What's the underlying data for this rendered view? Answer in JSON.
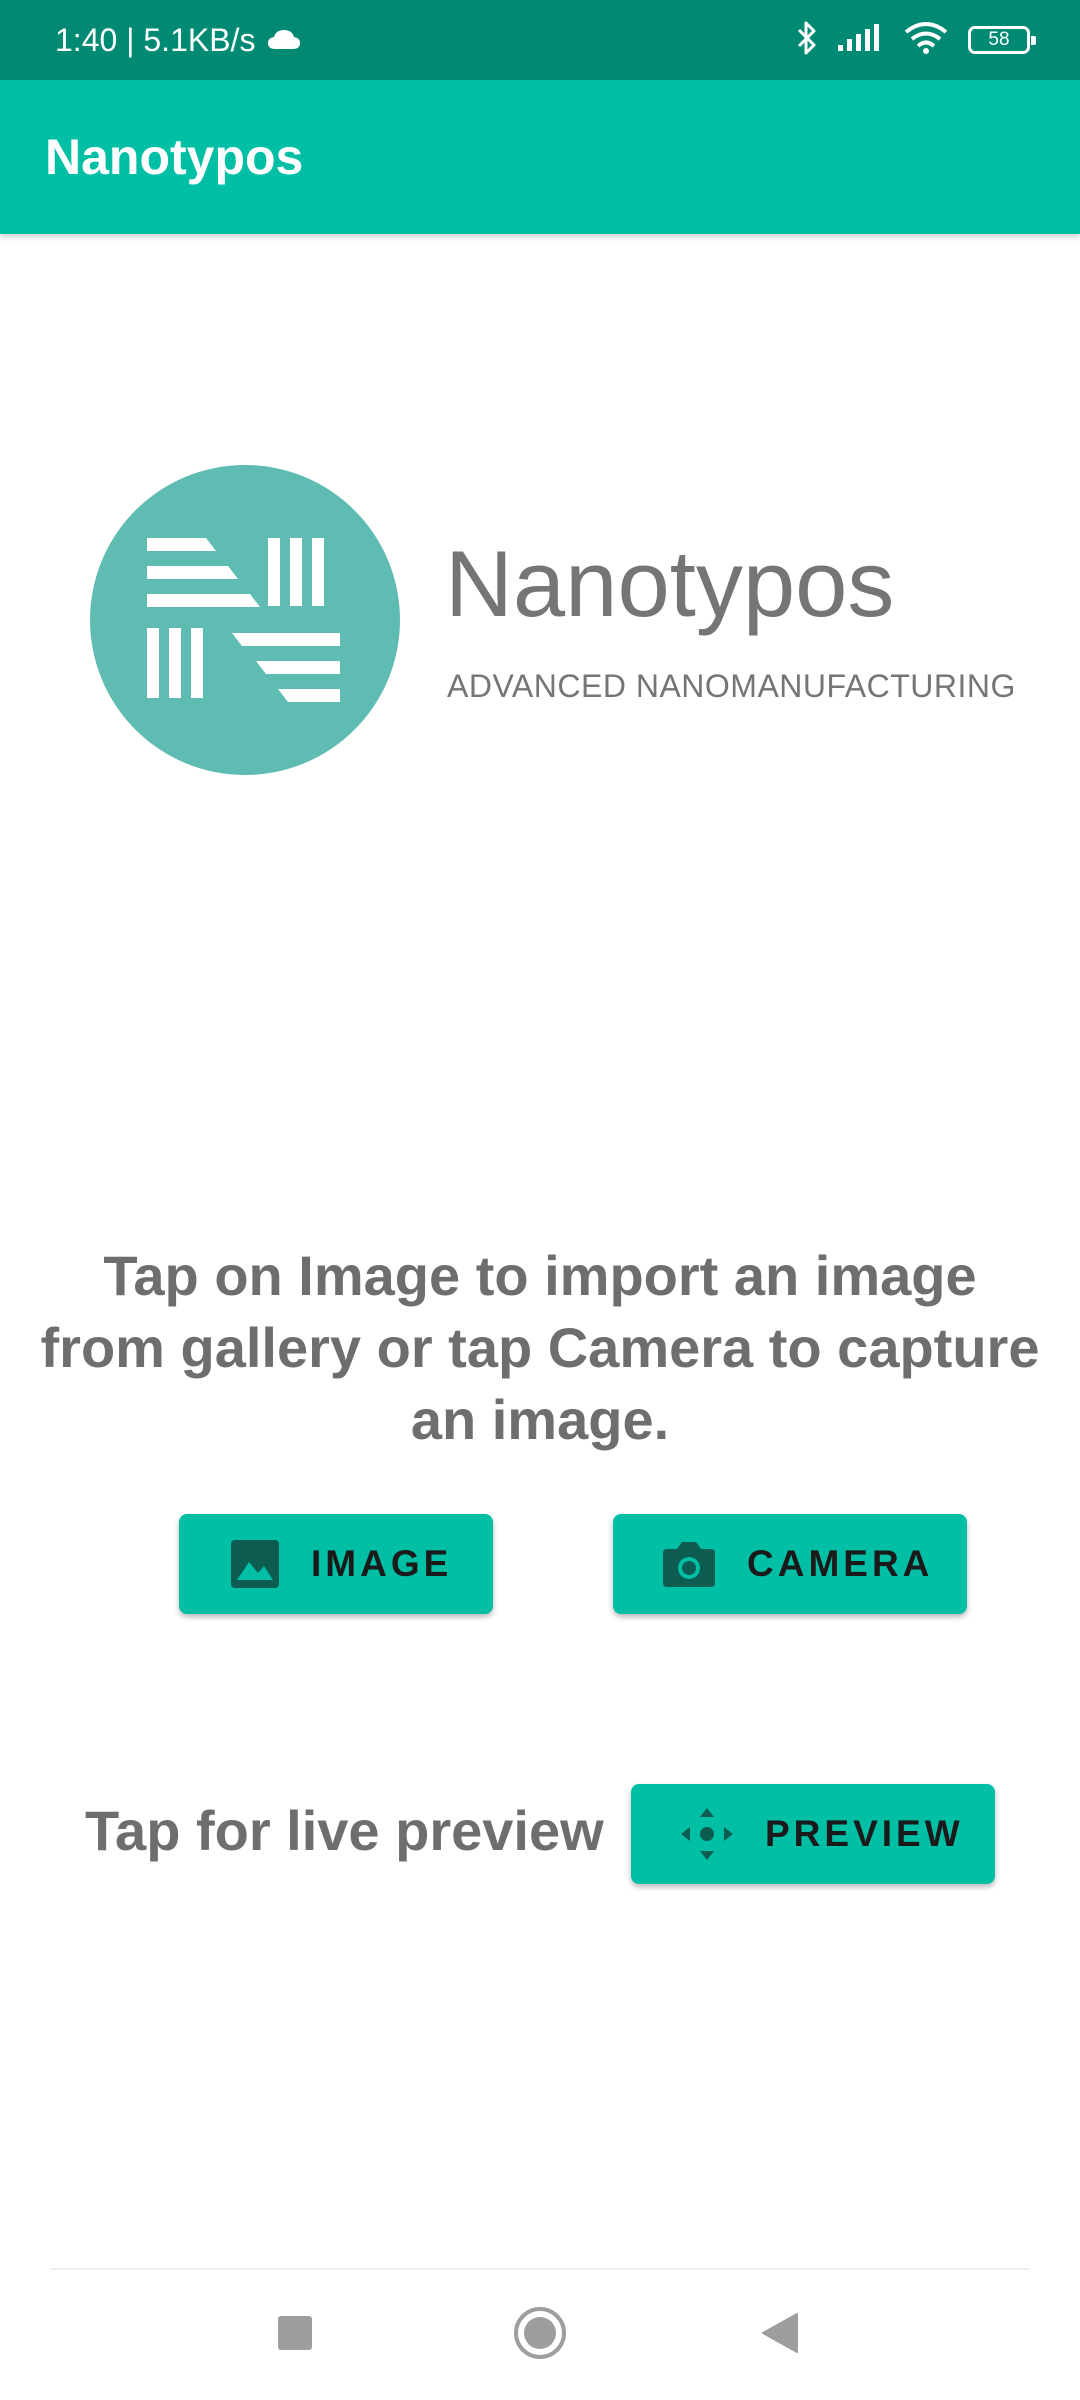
{
  "status_bar": {
    "time_and_speed": "1:40 | 5.1KB/s",
    "battery_level": "58",
    "icons": [
      "cloud-icon",
      "bluetooth-icon",
      "signal-icon",
      "wifi-icon",
      "battery-icon"
    ]
  },
  "app_bar": {
    "title": "Nanotypos"
  },
  "logo": {
    "name": "Nanotypos",
    "tagline": "ADVANCED NANOMANUFACTURING",
    "color": "#5fbcb3"
  },
  "main": {
    "instruction": "Tap on Image to import an image from gallery or tap Camera to capture an image.",
    "image_button": {
      "label": "IMAGE",
      "icon": "image-icon"
    },
    "camera_button": {
      "label": "CAMERA",
      "icon": "camera-icon"
    },
    "live_preview_label": "Tap for live preview",
    "preview_button": {
      "label": "PREVIEW",
      "icon": "move-icon"
    }
  },
  "navigation": {
    "items": [
      "recents-button",
      "home-button",
      "back-button"
    ]
  },
  "colors": {
    "status_bar": "#008a74",
    "accent": "#00bfa5",
    "text_gray": "#6e6e6e"
  }
}
